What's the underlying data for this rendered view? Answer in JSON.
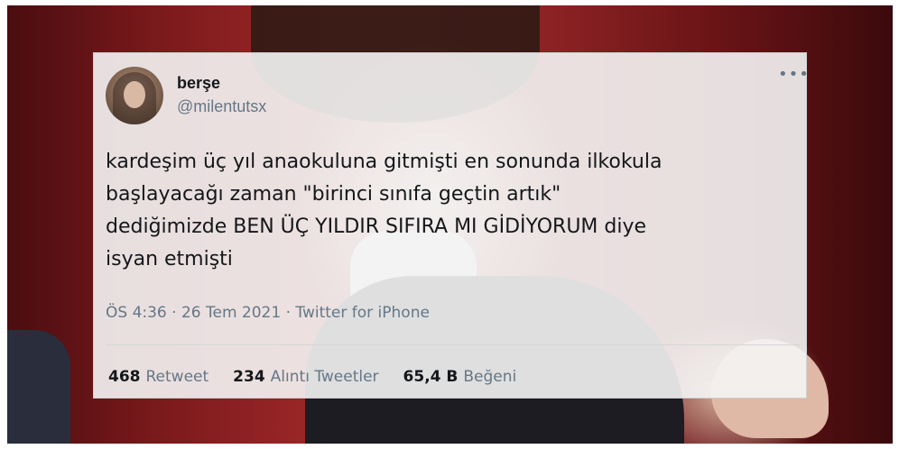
{
  "tweet": {
    "display_name": "berşe",
    "handle": "@milentutsx",
    "more_icon": "more-horizontal-icon",
    "text": "kardeşim üç yıl anaokuluna gitmişti en sonunda ilkokula\nbaşlayacağı zaman \"birinci sınıfa geçtin artık\"\ndediğimizde BEN ÜÇ YILDIR SIFIRA MI GİDİYORUM diye\nisyan etmişti",
    "meta": "ÖS 4:36 · 26 Tem 2021 · Twitter for iPhone",
    "stats": {
      "retweets": {
        "count": "468",
        "label": "Retweet"
      },
      "quotes": {
        "count": "234",
        "label": "Alıntı Tweetler"
      },
      "likes": {
        "count": "65,4 B",
        "label": "Beğeni"
      }
    }
  },
  "colors": {
    "text_primary": "#14171a",
    "text_secondary": "#657786"
  }
}
